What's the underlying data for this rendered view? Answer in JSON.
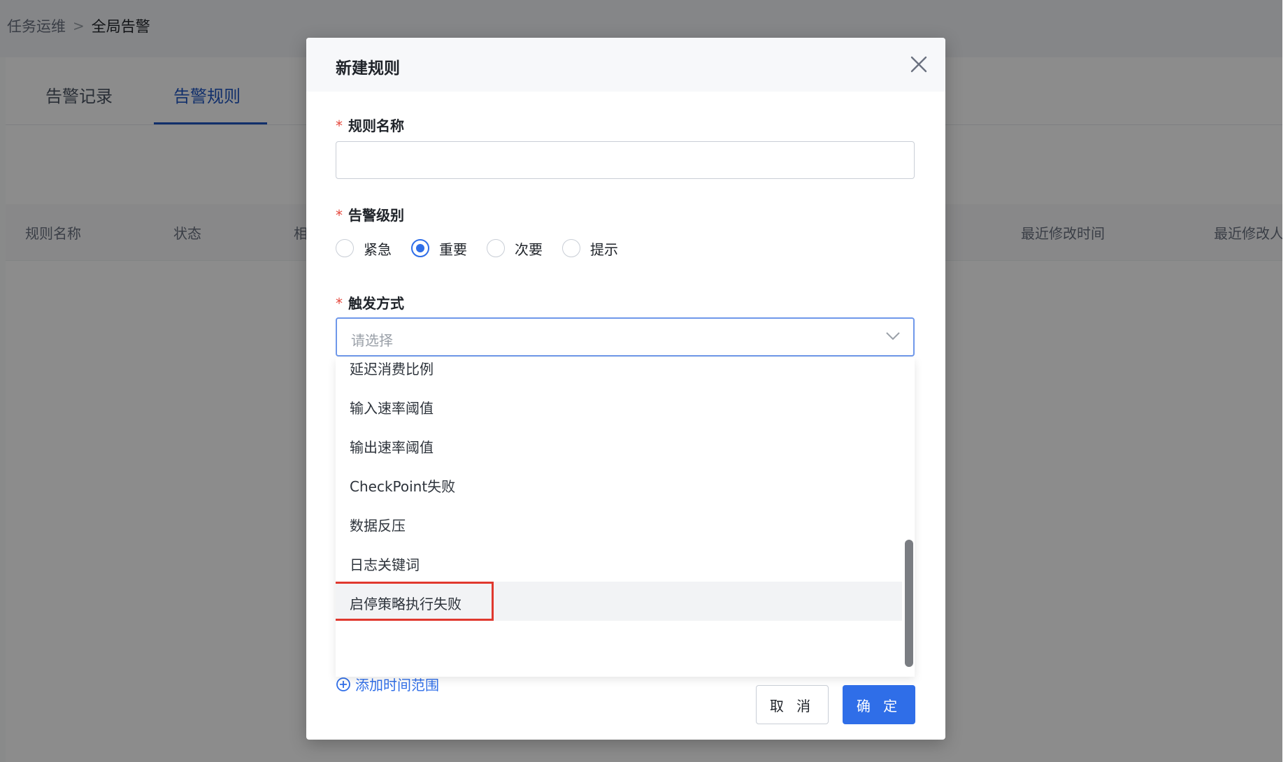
{
  "breadcrumb": {
    "parent": "任务运维",
    "separator": ">",
    "current": "全局告警"
  },
  "tabs": [
    {
      "label": "告警记录",
      "active": false
    },
    {
      "label": "告警规则",
      "active": true
    }
  ],
  "table": {
    "columns": [
      "规则名称",
      "状态",
      "相",
      "最近修改时间",
      "最近修改人"
    ]
  },
  "modal": {
    "title": "新建规则",
    "fields": {
      "rule_name": {
        "required_mark": "*",
        "label": "规则名称",
        "value": "",
        "placeholder": ""
      },
      "alert_level": {
        "required_mark": "*",
        "label": "告警级别",
        "options": [
          "紧急",
          "重要",
          "次要",
          "提示"
        ],
        "selected": "重要"
      },
      "trigger": {
        "required_mark": "*",
        "label": "触发方式",
        "placeholder": "请选择",
        "options": [
          "延迟消费比例",
          "输入速率阈值",
          "输出速率阈值",
          "CheckPoint失败",
          "数据反压",
          "日志关键词",
          "启停策略执行失败"
        ],
        "hovered": "启停策略执行失败"
      }
    },
    "add_time_range": "添加时间范围",
    "buttons": {
      "cancel": "取 消",
      "confirm": "确 定"
    }
  },
  "colors": {
    "primary": "#2f6ee8",
    "required": "#e5483d",
    "highlight": "#e0382e"
  }
}
